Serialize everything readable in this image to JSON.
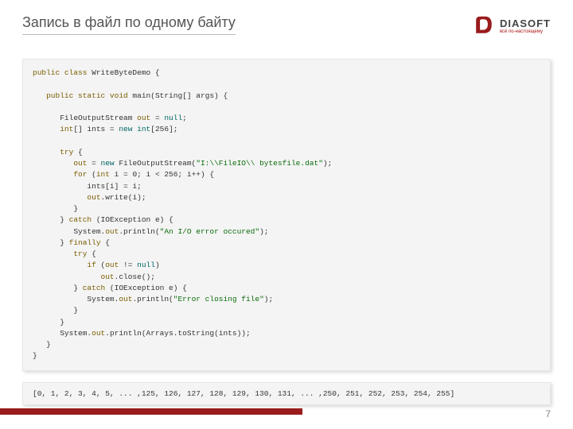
{
  "slide": {
    "title": "Запись в файл по одному байту",
    "page_number": "7"
  },
  "logo": {
    "word": "DIASOFT",
    "tagline": "всё по-настоящему",
    "fill": "#9a1b1b"
  },
  "code": {
    "l01a": "public class",
    "l01b": " WriteByteDemo {",
    "l02a": "public static void",
    "l02b": " main(String[] args) {",
    "l03a": "FileOutputStream ",
    "l03b": "out",
    "l03c": " = ",
    "l03d": "null",
    "l03e": ";",
    "l04a": "int",
    "l04b": "[] ints = ",
    "l04c": "new int",
    "l04d": "[256];",
    "l05a": "try",
    "l05b": " {",
    "l06a": "out",
    "l06b": " = ",
    "l06c": "new",
    "l06d": " FileOutputStream(",
    "l06e": "\"I:\\\\FileIO\\\\ bytesfile.dat\"",
    "l06f": ");",
    "l07a": "for",
    "l07b": " (",
    "l07c": "int",
    "l07d": " i = 0; i < 256; i++) {",
    "l08": "ints[i] = i;",
    "l09a": "out",
    "l09b": ".write(i);",
    "l10": "}",
    "l11a": "} ",
    "l11b": "catch",
    "l11c": " (IOException e) {",
    "l12a": "System.",
    "l12b": "out",
    "l12c": ".println(",
    "l12d": "\"An I/O error occured\"",
    "l12e": ");",
    "l13a": "} ",
    "l13b": "finally",
    "l13c": " {",
    "l14a": "try",
    "l14b": " {",
    "l15a": "if",
    "l15b": " (",
    "l15c": "out",
    "l15d": " != ",
    "l15e": "null",
    "l15f": ")",
    "l16a": "out",
    "l16b": ".close();",
    "l17a": "} ",
    "l17b": "catch",
    "l17c": " (IOException e) {",
    "l18a": "System.",
    "l18b": "out",
    "l18c": ".println(",
    "l18d": "\"Error closing file\"",
    "l18e": ");",
    "l19": "}",
    "l20": "}",
    "l21a": "System.",
    "l21b": "out",
    "l21c": ".println(Arrays.toString(ints));",
    "l22": "}",
    "l23": "}"
  },
  "output": {
    "text": "[0, 1, 2, 3, 4, 5, ... ,125, 126, 127, 128, 129, 130, 131, ... ,250, 251, 252, 253, 254, 255]"
  }
}
